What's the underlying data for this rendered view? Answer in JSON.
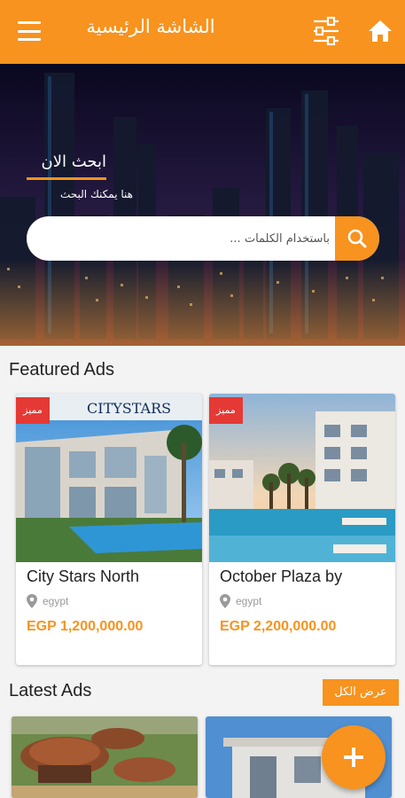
{
  "header": {
    "title": "الشاشة الرئيسية",
    "menu_icon": "menu-icon",
    "filter_icon": "sliders-icon",
    "home_icon": "home-icon"
  },
  "hero": {
    "heading": "ابحث الان",
    "subheading": "هنا يمكنك البحث",
    "search_placeholder": "باستخدام الكلمات ...",
    "search_icon": "search-icon"
  },
  "featured": {
    "title": "Featured Ads",
    "ads": [
      {
        "badge": "مميز",
        "title": "City Stars North",
        "location": "egypt",
        "price": "EGP 1,200,000.00",
        "image_sign": "CITYSTARS"
      },
      {
        "badge": "مميز",
        "title": "October Plaza by",
        "location": "egypt",
        "price": "EGP 2,200,000.00"
      }
    ]
  },
  "latest": {
    "title": "Latest Ads",
    "view_all": "عرض الكل"
  },
  "fab": {
    "icon": "plus-icon"
  },
  "colors": {
    "accent": "#f7931e",
    "badge": "#e53935",
    "price": "#f7931e"
  }
}
